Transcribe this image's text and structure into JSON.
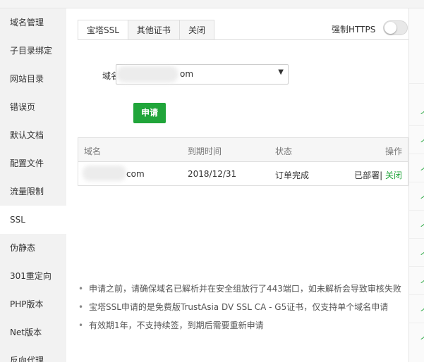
{
  "sidebar": {
    "items": [
      {
        "label": "域名管理"
      },
      {
        "label": "子目录绑定"
      },
      {
        "label": "网站目录"
      },
      {
        "label": "错误页"
      },
      {
        "label": "默认文档"
      },
      {
        "label": "配置文件"
      },
      {
        "label": "流量限制"
      },
      {
        "label": "SSL"
      },
      {
        "label": "伪静态"
      },
      {
        "label": "301重定向"
      },
      {
        "label": "PHP版本"
      },
      {
        "label": "Net版本"
      },
      {
        "label": "反向代理"
      }
    ],
    "active": "SSL"
  },
  "tabs": [
    {
      "label": "宝塔SSL"
    },
    {
      "label": "其他证书"
    },
    {
      "label": "关闭"
    }
  ],
  "https_toggle": {
    "label": "强制HTTPS",
    "enabled": false
  },
  "form": {
    "domain_label": "域名",
    "domain_value": "om",
    "apply_button": "申请"
  },
  "table": {
    "headers": [
      "域名",
      "到期时间",
      "状态",
      "操作"
    ],
    "rows": [
      {
        "domain": "com",
        "expire": "2018/12/31",
        "status": "订单完成",
        "deployed": "已部署",
        "separator": "|",
        "action": "关闭"
      }
    ]
  },
  "notes": [
    "申请之前，请确保域名已解析并在安全组放行了443端口，如未解析会导致审核失败",
    "宝塔SSL申请的是免费版TrustAsia DV SSL CA - G5证书，仅支持单个域名申请",
    "有效期1年，不支持续签，到期后需要重新申请"
  ],
  "colors": {
    "accent": "#20a53a",
    "sidebar_bg": "#f2f2f2",
    "header_bg": "#f6f6f6"
  },
  "edge_glyph": "个"
}
